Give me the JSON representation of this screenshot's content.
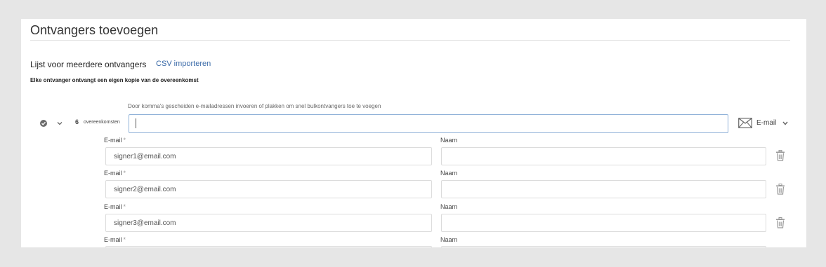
{
  "header": {
    "title": "Ontvangers toevoegen"
  },
  "list": {
    "label": "Lijst voor meerdere ontvangers",
    "csv_link": "CSV importeren",
    "copy_note": "Elke ontvanger ontvangt een eigen kopie van de overeenkomst"
  },
  "bulk": {
    "hint": "Door komma's gescheiden e-mailadressen invoeren of plakken om snel bulkontvangers toe te voegen",
    "count": "6",
    "count_label": "overeenkomsten",
    "input_value": "",
    "type_label": "E-mail"
  },
  "fields": {
    "email_label": "E-mail",
    "required_mark": "*",
    "name_label": "Naam"
  },
  "recipients": [
    {
      "email": "signer1@email.com",
      "name": ""
    },
    {
      "email": "signer2@email.com",
      "name": ""
    },
    {
      "email": "signer3@email.com",
      "name": ""
    }
  ],
  "icons": [
    "check-circle-icon",
    "chevron-down-icon",
    "mail-icon",
    "trash-icon"
  ],
  "colors": {
    "link": "#3a6aa8",
    "input_focus_border": "#8fb1d8",
    "page_bg": "#e6e6e6"
  }
}
